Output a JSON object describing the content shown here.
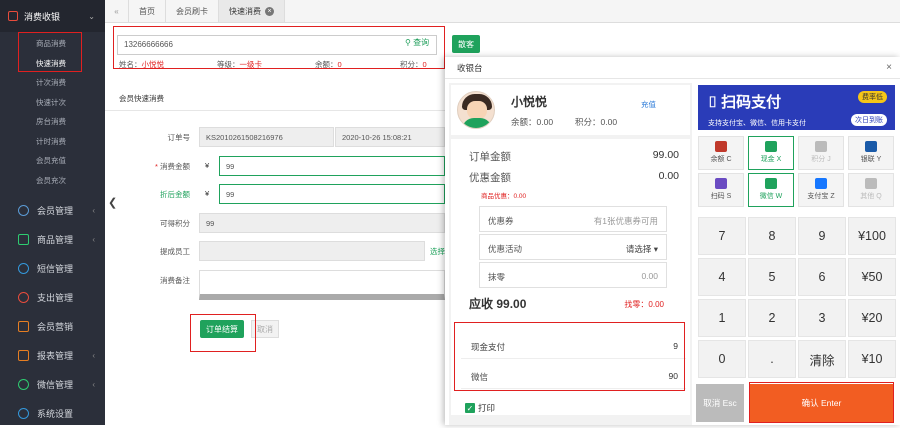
{
  "sidebar": {
    "header": "消费收银",
    "sub_items": [
      "商品消费",
      "快速消费",
      "计次消费",
      "快速计次",
      "房台消费",
      "计时消费",
      "会员充值",
      "会员充次"
    ],
    "menus": [
      "会员管理",
      "商品管理",
      "短信管理",
      "支出管理",
      "会员营销",
      "报表管理",
      "微信管理",
      "系统设置"
    ]
  },
  "topbar": {
    "collapse_icon": "«",
    "tabs": [
      "首页",
      "会员刷卡",
      "快速消费"
    ],
    "tab_close": "×"
  },
  "member": {
    "search_value": "13266666666",
    "search_label": "查询",
    "card_button": "散客",
    "name_label": "姓名：",
    "name": "小悦悦",
    "level_label": "等级：",
    "level": "一级卡",
    "balance_label": "余额：",
    "balance": "0",
    "points_label": "积分：",
    "points": "0"
  },
  "form": {
    "section_title": "会员快速消费",
    "order_label": "订单号",
    "order_no": "KS2010261508216976",
    "order_time": "2020-10-26 15:08:21",
    "consume_label": "消费金额",
    "consume_value": "99",
    "discount_label": "折后金额",
    "discount_value": "99",
    "points_label": "可得积分",
    "points_value": "99",
    "staff_label": "提成员工",
    "staff_select": "选择",
    "remark_label": "消费备注",
    "yen": "¥",
    "submit": "订单结算",
    "cancel": "取消"
  },
  "cashier": {
    "title": "收银台",
    "close": "×",
    "customer": {
      "name": "小悦悦",
      "recharge": "充值",
      "balance_label": "余额：",
      "balance": "0.00",
      "points_label": "积分：",
      "points": "0.00"
    },
    "order_amount_label": "订单金额",
    "order_amount": "99.00",
    "discount_label": "优惠金额",
    "discount": "0.00",
    "product_discount": "商品优惠：0.00",
    "coupon_label": "优惠券",
    "coupon_value": "有1张优惠券可用",
    "activity_label": "优惠活动",
    "activity_value": "请选择",
    "rounding_label": "抹零",
    "rounding_value": "0.00",
    "due_label": "应收",
    "due": "99.00",
    "change_label": "找零：",
    "change": "0.00",
    "payments": [
      {
        "label": "现金支付",
        "value": "9"
      },
      {
        "label": "微信",
        "value": "90"
      }
    ],
    "print_label": "打印",
    "banner": {
      "title": "扫码支付",
      "tag": "费率低",
      "subtitle": "支持支付宝、微信、信用卡支付",
      "tag2": "次日到账"
    },
    "pay_methods": [
      {
        "label": "余额 C",
        "icon": "wallet-icon",
        "state": "normal",
        "color": "#c0392b"
      },
      {
        "label": "现金 X",
        "icon": "cash-icon",
        "state": "active",
        "color": "#1fa25c"
      },
      {
        "label": "积分 J",
        "icon": "points-icon",
        "state": "disabled",
        "color": "#bbbbbb"
      },
      {
        "label": "银联 Y",
        "icon": "unionpay-icon",
        "state": "normal",
        "color": "#1a5aa8"
      },
      {
        "label": "扫码 S",
        "icon": "scan-icon",
        "state": "normal",
        "color": "#6a4bc2"
      },
      {
        "label": "微信 W",
        "icon": "wechat-icon",
        "state": "active",
        "color": "#1fa25c"
      },
      {
        "label": "支付宝 Z",
        "icon": "alipay-icon",
        "state": "normal",
        "color": "#1677ff"
      },
      {
        "label": "其他 Q",
        "icon": "more-icon",
        "state": "disabled",
        "color": "#bbbbbb"
      }
    ],
    "keys": [
      "7",
      "8",
      "9",
      "¥100",
      "4",
      "5",
      "6",
      "¥50",
      "1",
      "2",
      "3",
      "¥20",
      "0",
      ".",
      "清除",
      "¥10"
    ],
    "cancel_key": "取消 Esc",
    "confirm_key": "确认 Enter"
  }
}
